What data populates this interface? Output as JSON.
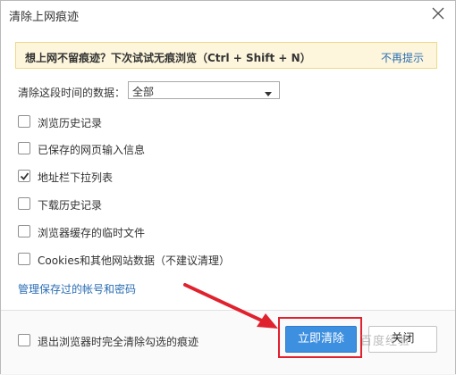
{
  "dialog": {
    "title": "清除上网痕迹",
    "close_icon": "close-icon"
  },
  "notice": {
    "text": "想上网不留痕迹？下次试试无痕浏览（Ctrl + Shift + N）",
    "dismiss_link": "不再提示",
    "background_color": "#fdf6dc"
  },
  "range": {
    "label": "清除这段时间的数据：",
    "selected": "全部",
    "icon": "dropdown-caret-icon"
  },
  "options": [
    {
      "label": "浏览历史记录",
      "checked": false
    },
    {
      "label": "已保存的网页输入信息",
      "checked": false
    },
    {
      "label": "地址栏下拉列表",
      "checked": true
    },
    {
      "label": "下载历史记录",
      "checked": false
    },
    {
      "label": "浏览器缓存的临时文件",
      "checked": false
    },
    {
      "label": "Cookies和其他网站数据（不建议清理）",
      "checked": false
    }
  ],
  "manage_link": "管理保存过的帐号和密码",
  "footer": {
    "exit_clear_label": "退出浏览器时完全清除勾选的痕迹",
    "exit_clear_checked": false,
    "clear_button": "立即清除",
    "close_button": "关闭",
    "watermark": "百度经验"
  },
  "colors": {
    "primary": "#3d8fe0",
    "link": "#2a6db3",
    "annotation_red": "#e0212e"
  }
}
